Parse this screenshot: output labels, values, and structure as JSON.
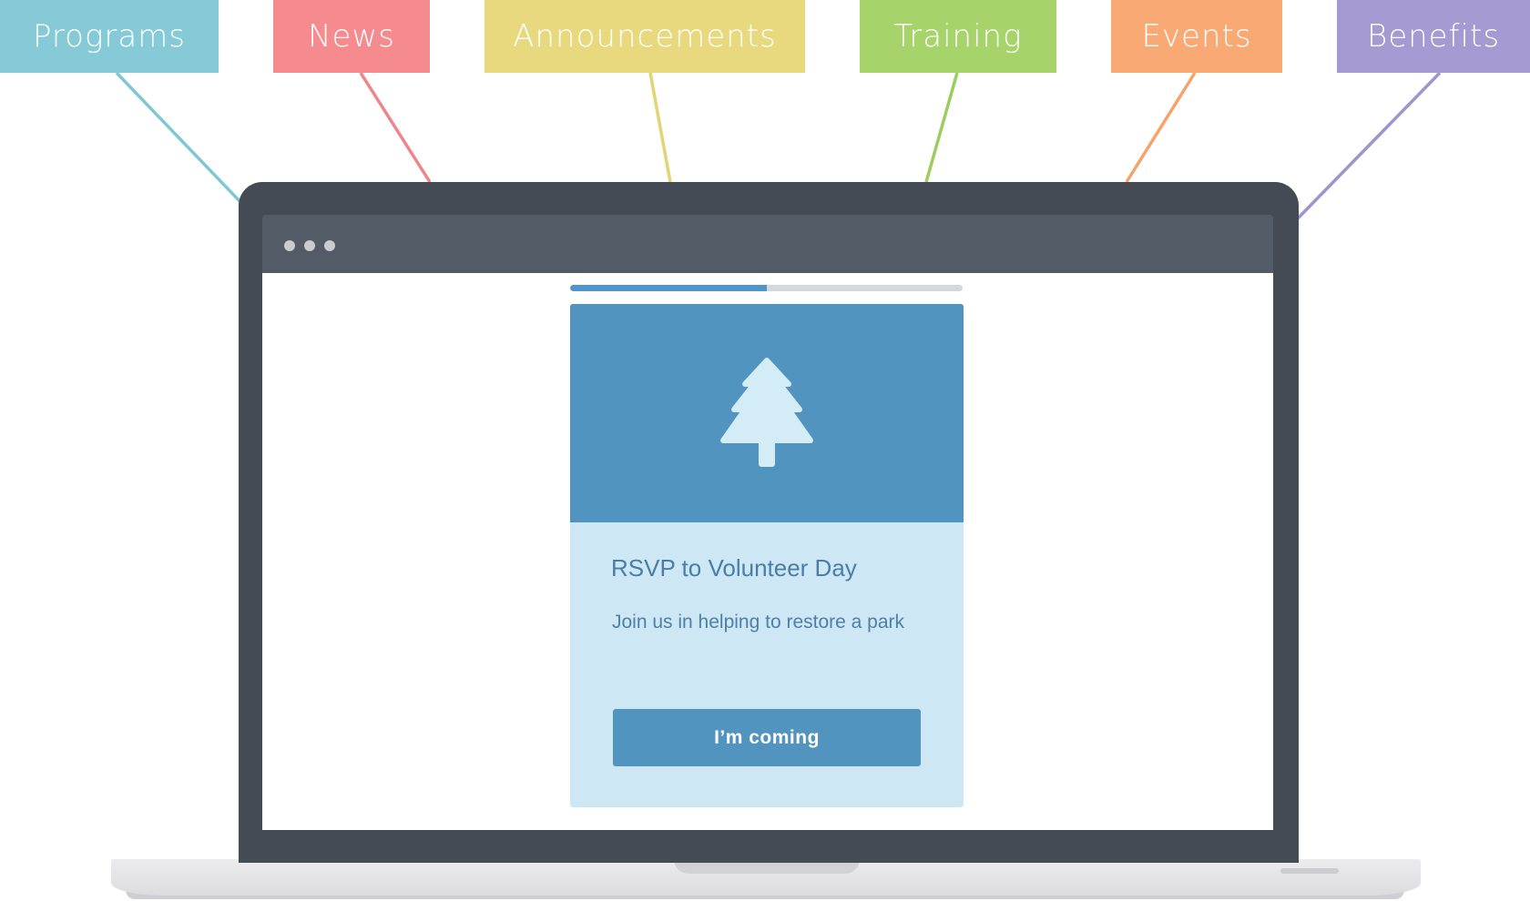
{
  "categories": [
    {
      "label": "Programs",
      "color": "#85cad6",
      "line_color": "#7ec7d4"
    },
    {
      "label": "News",
      "color": "#f58b8f",
      "line_color": "#f08589"
    },
    {
      "label": "Announcements",
      "color": "#e8d87e",
      "line_color": "#e3d474"
    },
    {
      "label": "Training",
      "color": "#a6d36a",
      "line_color": "#9ccd5e"
    },
    {
      "label": "Events",
      "color": "#f9a973",
      "line_color": "#f5a36b"
    },
    {
      "label": "Benefits",
      "color": "#a59bd2",
      "line_color": "#9e95cc"
    }
  ],
  "browser": {
    "window_dots": 3
  },
  "progress": {
    "fraction": 0.5,
    "fill_color": "#4e95cb"
  },
  "card": {
    "icon": "tree-icon",
    "title": "RSVP to Volunteer Day",
    "body": "Join us in helping to restore a park",
    "button_label": "I’m coming"
  },
  "colors": {
    "bezel": "#444b55",
    "toolbar": "#525b66",
    "card_header": "#5294c0",
    "card_body": "#cde7f5",
    "card_text": "#4a7ea7"
  }
}
